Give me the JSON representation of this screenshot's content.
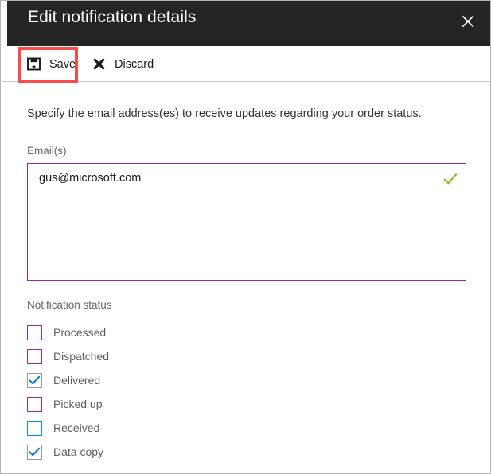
{
  "window": {
    "title": "Edit notification details",
    "close_icon": "close-icon"
  },
  "toolbar": {
    "save_label": "Save",
    "save_icon": "save-floppy-icon",
    "discard_label": "Discard",
    "discard_icon": "cross-icon",
    "highlight_color": "#fa4b4b"
  },
  "form": {
    "description": "Specify the email address(es) to receive updates regarding your order status.",
    "email_label": "Email(s)",
    "email_value": "gus@microsoft.com",
    "email_placeholder": "",
    "email_border_color": "#9b299b",
    "valid_icon": "check-icon",
    "valid_icon_color": "#8cbf26",
    "status_label": "Notification status",
    "checkboxes": [
      {
        "label": "Processed",
        "checked": false,
        "border": "purple"
      },
      {
        "label": "Dispatched",
        "checked": false,
        "border": "purple"
      },
      {
        "label": "Delivered",
        "checked": true,
        "border": "gray"
      },
      {
        "label": "Picked up",
        "checked": false,
        "border": "purple"
      },
      {
        "label": "Received",
        "checked": false,
        "border": "blue"
      },
      {
        "label": "Data copy",
        "checked": true,
        "border": "gray"
      }
    ],
    "check_color": "#0078d7"
  },
  "colors": {
    "header_bg": "#252525",
    "accent_purple": "#9b299b",
    "accent_blue": "#0095e0",
    "panel_border": "#b5b5b5"
  }
}
